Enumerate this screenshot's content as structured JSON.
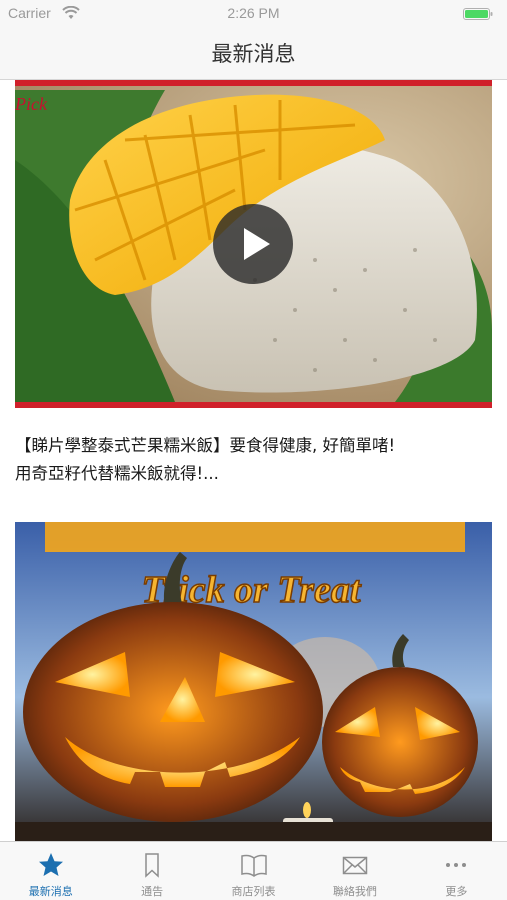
{
  "status_bar": {
    "carrier": "Carrier",
    "time": "2:26 PM"
  },
  "nav": {
    "title": "最新消息"
  },
  "feed": {
    "posts": [
      {
        "caption_line1": "【睇片學整泰式芒果糯米飯】要食得健康, 好簡單啫!",
        "caption_line2": "用奇亞籽代替糯米飯就得!...",
        "media": "mango-chia-pudding-video",
        "has_video": true
      },
      {
        "banner_text": "Trick or Treat",
        "media": "halloween-pumpkins-image",
        "has_video": false
      }
    ]
  },
  "tabbar": {
    "items": [
      {
        "label": "最新消息",
        "icon": "star-icon",
        "active": true
      },
      {
        "label": "通告",
        "icon": "bookmark-icon",
        "active": false
      },
      {
        "label": "商店列表",
        "icon": "book-icon",
        "active": false
      },
      {
        "label": "聯絡我們",
        "icon": "envelope-icon",
        "active": false
      },
      {
        "label": "更多",
        "icon": "more-icon",
        "active": false
      }
    ]
  },
  "colors": {
    "accent": "#1c6fb0",
    "tab_inactive": "#8e8e8e",
    "battery": "#4cd964",
    "video_frame_red": "#d0202a"
  }
}
